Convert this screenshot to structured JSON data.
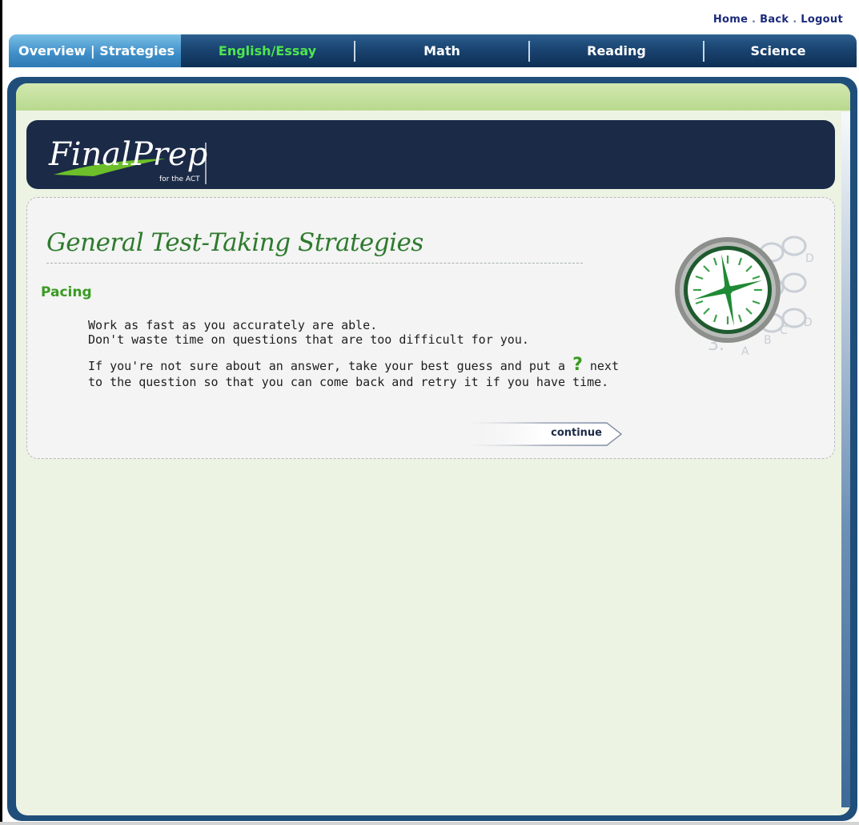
{
  "top_links": {
    "home": "Home",
    "back": "Back",
    "logout": "Logout",
    "sep": "."
  },
  "nav": {
    "tabs": [
      {
        "label": "Overview | Strategies"
      },
      {
        "label": "English/Essay"
      },
      {
        "label": "Math"
      },
      {
        "label": "Reading"
      },
      {
        "label": "Science"
      }
    ]
  },
  "logo": {
    "main": "FinalPrep",
    "sub": "for the ACT"
  },
  "content": {
    "title": "General Test-Taking Strategies",
    "subheading": "Pacing",
    "line1": "Work as fast as you accurately are able.",
    "line2": "Don't waste time on questions that are too difficult for you.",
    "line3a": "If you're not sure about an answer, take your best guess and put a",
    "qmark": "?",
    "line3b": "next",
    "line4": "to the question so that you can come back and retry it if you have time.",
    "continue_label": "continue"
  },
  "colors": {
    "nav_blue": "#1a4471",
    "active_tab": "#3f8ec7",
    "accent_green": "#3a9b22",
    "banner": "#1b2a47"
  }
}
